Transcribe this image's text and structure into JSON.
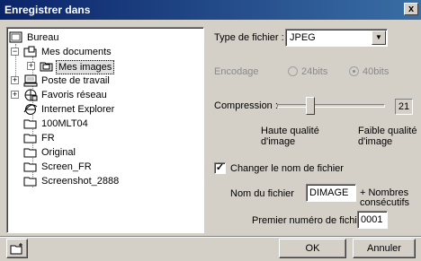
{
  "window": {
    "title": "Enregistrer dans",
    "close_glyph": "x"
  },
  "tree": {
    "items": [
      {
        "label": "Bureau",
        "icon": "desktop-icon"
      },
      {
        "label": "Mes documents",
        "icon": "my-documents-folder-icon"
      },
      {
        "label": "Mes images",
        "icon": "my-pictures-folder-icon"
      },
      {
        "label": "Poste de travail",
        "icon": "my-computer-icon"
      },
      {
        "label": "Favoris réseau",
        "icon": "network-places-icon"
      },
      {
        "label": "Internet Explorer",
        "icon": "internet-explorer-icon"
      },
      {
        "label": "100MLT04",
        "icon": "folder-icon"
      },
      {
        "label": "FR",
        "icon": "folder-icon"
      },
      {
        "label": "Original",
        "icon": "folder-icon"
      },
      {
        "label": "Screen_FR",
        "icon": "folder-icon"
      },
      {
        "label": "Screenshot_2888",
        "icon": "folder-icon"
      }
    ],
    "expander_plus": "+",
    "expander_minus": "−"
  },
  "options": {
    "file_type_label": "Type de fichier :",
    "file_type_value": "JPEG",
    "dropdown_glyph": "▼",
    "encoding_label": "Encodage",
    "encoding_24": "24bits",
    "encoding_40": "40bits",
    "compression_label": "Compression :",
    "compression_value": "21",
    "high_quality": "Haute qualité\nd'image",
    "low_quality": "Faible qualité\nd'image",
    "rename_checkbox_label": "Changer le nom de fichier",
    "rename_checked_glyph": "✓",
    "filename_label": "Nom du fichier",
    "filename_value": "DIMAGE",
    "numbers_note": "+ Nombres\nconsécutifs",
    "first_number_label": "Premier numéro de fichier",
    "first_number_value": "0001"
  },
  "buttons": {
    "ok": "OK",
    "cancel": "Annuler"
  },
  "colors": {
    "titlebar_start": "#0a246a",
    "titlebar_end": "#3a6ea5",
    "face": "#d4d0c8"
  }
}
